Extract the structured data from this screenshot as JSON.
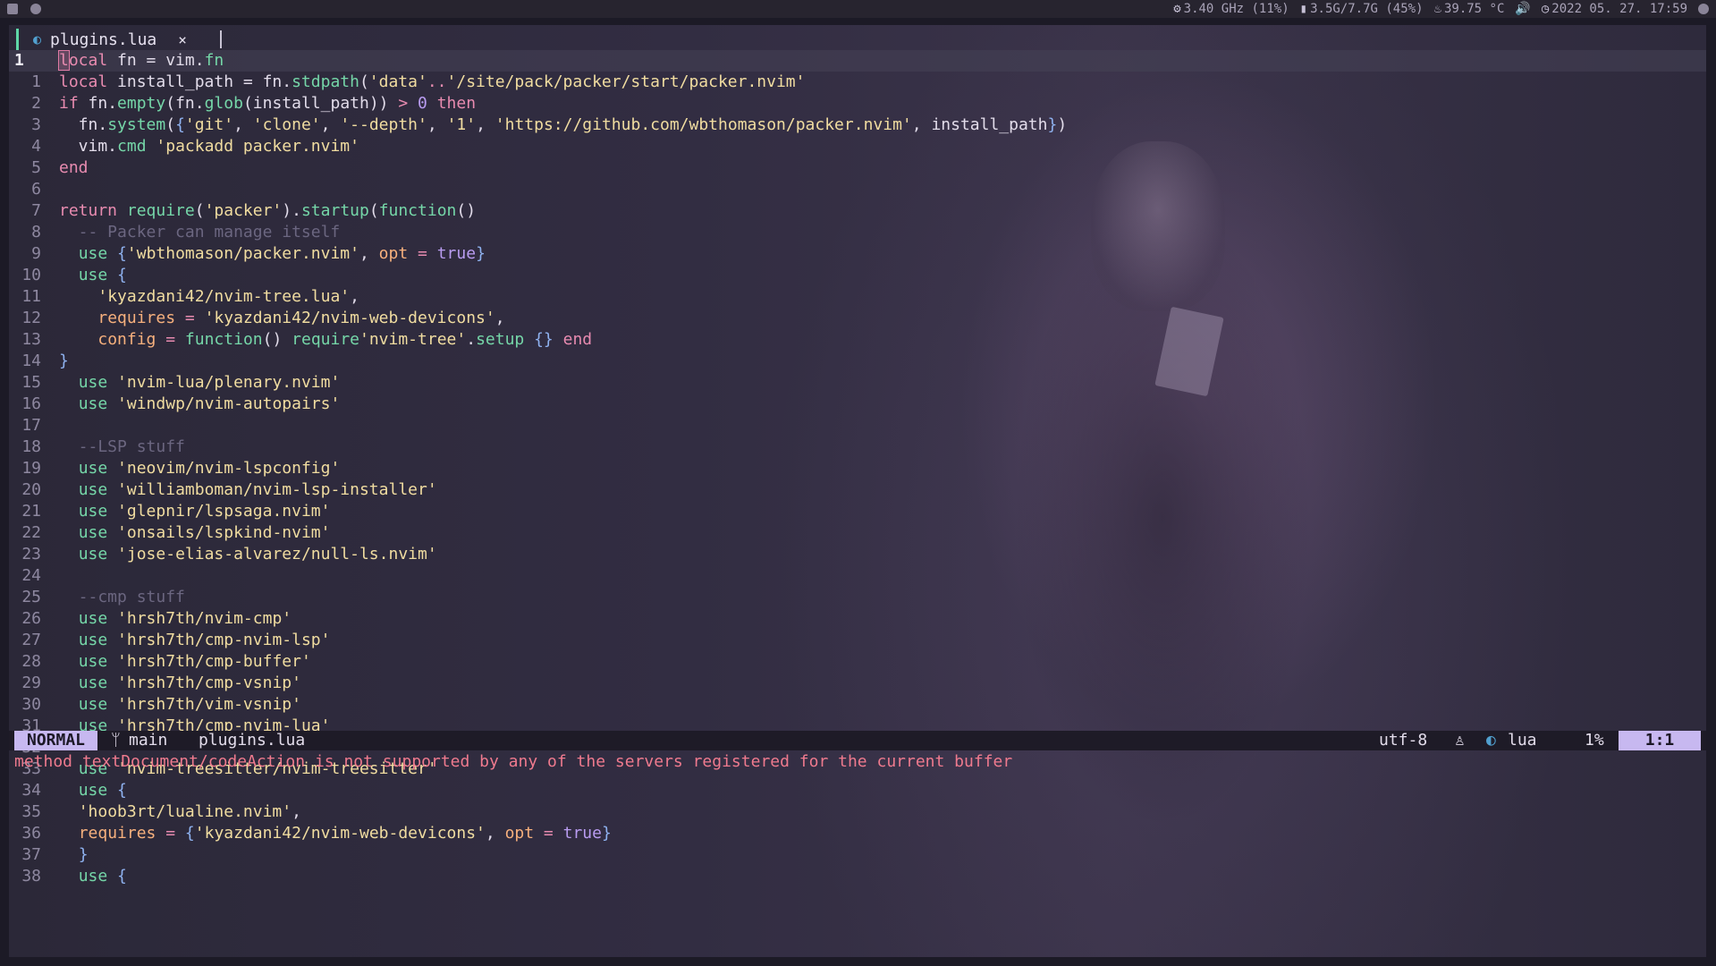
{
  "topbar": {
    "cpu": "3.40 GHz (11%)",
    "memory": "3.5G/7.7G (45%)",
    "temperature": "39.75 °C",
    "datetime": "2022 05. 27. 17:59"
  },
  "tab": {
    "filename": "plugins.lua",
    "close_glyph": "×"
  },
  "lines": [
    {
      "n": "1",
      "current": true,
      "seg": [
        [
          "cur",
          "l"
        ],
        [
          "k",
          "ocal"
        ],
        [
          "p",
          " fn = vim."
        ],
        [
          "f",
          "fn"
        ]
      ]
    },
    {
      "n": "1",
      "seg": [
        [
          "k",
          "local"
        ],
        [
          "p",
          " install_path = fn."
        ],
        [
          "f",
          "stdpath"
        ],
        [
          "p",
          "("
        ],
        [
          "s",
          "'data'"
        ],
        [
          "o",
          ".."
        ],
        [
          "s",
          "'/site/pack/packer/start/packer.nvim'"
        ]
      ]
    },
    {
      "n": "2",
      "seg": [
        [
          "k",
          "if"
        ],
        [
          "p",
          " fn."
        ],
        [
          "f",
          "empty"
        ],
        [
          "p",
          "(fn."
        ],
        [
          "f",
          "glob"
        ],
        [
          "p",
          "(install_path)) "
        ],
        [
          "o",
          ">"
        ],
        [
          "p",
          " "
        ],
        [
          "n",
          "0"
        ],
        [
          "p",
          " "
        ],
        [
          "k",
          "then"
        ]
      ]
    },
    {
      "n": "3",
      "seg": [
        [
          "p",
          "  fn."
        ],
        [
          "f",
          "system"
        ],
        [
          "p",
          "("
        ],
        [
          "b",
          "{"
        ],
        [
          "s",
          "'git'"
        ],
        [
          "p",
          ", "
        ],
        [
          "s",
          "'clone'"
        ],
        [
          "p",
          ", "
        ],
        [
          "s",
          "'--depth'"
        ],
        [
          "p",
          ", "
        ],
        [
          "s",
          "'1'"
        ],
        [
          "p",
          ", "
        ],
        [
          "s",
          "'https://github.com/wbthomason/packer.nvim'"
        ],
        [
          "p",
          ", install_path"
        ],
        [
          "b",
          "}"
        ],
        [
          "p",
          ")"
        ]
      ]
    },
    {
      "n": "4",
      "seg": [
        [
          "p",
          "  vim."
        ],
        [
          "f",
          "cmd"
        ],
        [
          "p",
          " "
        ],
        [
          "s",
          "'packadd packer.nvim'"
        ]
      ]
    },
    {
      "n": "5",
      "seg": [
        [
          "k",
          "end"
        ]
      ]
    },
    {
      "n": "6",
      "seg": []
    },
    {
      "n": "7",
      "seg": [
        [
          "k",
          "return"
        ],
        [
          "p",
          " "
        ],
        [
          "f",
          "require"
        ],
        [
          "p",
          "("
        ],
        [
          "s",
          "'packer'"
        ],
        [
          "p",
          ")."
        ],
        [
          "f",
          "startup"
        ],
        [
          "p",
          "("
        ],
        [
          "f",
          "function"
        ],
        [
          "p",
          "()"
        ]
      ]
    },
    {
      "n": "8",
      "seg": [
        [
          "c",
          "  -- Packer can manage itself"
        ]
      ]
    },
    {
      "n": "9",
      "seg": [
        [
          "p",
          "  "
        ],
        [
          "f",
          "use"
        ],
        [
          "p",
          " "
        ],
        [
          "b",
          "{"
        ],
        [
          "s",
          "'wbthomason/packer.nvim'"
        ],
        [
          "p",
          ", "
        ],
        [
          "a",
          "opt"
        ],
        [
          "p",
          " "
        ],
        [
          "o",
          "="
        ],
        [
          "p",
          " "
        ],
        [
          "n",
          "true"
        ],
        [
          "b",
          "}"
        ]
      ]
    },
    {
      "n": "10",
      "seg": [
        [
          "p",
          "  "
        ],
        [
          "f",
          "use"
        ],
        [
          "p",
          " "
        ],
        [
          "b",
          "{"
        ]
      ]
    },
    {
      "n": "11",
      "seg": [
        [
          "p",
          "    "
        ],
        [
          "s",
          "'kyazdani42/nvim-tree.lua'"
        ],
        [
          "p",
          ","
        ]
      ]
    },
    {
      "n": "12",
      "seg": [
        [
          "p",
          "    "
        ],
        [
          "a",
          "requires"
        ],
        [
          "p",
          " "
        ],
        [
          "o",
          "="
        ],
        [
          "p",
          " "
        ],
        [
          "s",
          "'kyazdani42/nvim-web-devicons'"
        ],
        [
          "p",
          ","
        ]
      ]
    },
    {
      "n": "13",
      "seg": [
        [
          "p",
          "    "
        ],
        [
          "a",
          "config"
        ],
        [
          "p",
          " "
        ],
        [
          "o",
          "="
        ],
        [
          "p",
          " "
        ],
        [
          "f",
          "function"
        ],
        [
          "p",
          "() "
        ],
        [
          "f",
          "require"
        ],
        [
          "s",
          "'nvim-tree'"
        ],
        [
          "p",
          "."
        ],
        [
          "f",
          "setup"
        ],
        [
          "p",
          " "
        ],
        [
          "b",
          "{}"
        ],
        [
          "p",
          " "
        ],
        [
          "k",
          "end"
        ]
      ]
    },
    {
      "n": "14",
      "seg": [
        [
          "b",
          "}"
        ]
      ]
    },
    {
      "n": "15",
      "seg": [
        [
          "p",
          "  "
        ],
        [
          "f",
          "use"
        ],
        [
          "p",
          " "
        ],
        [
          "s",
          "'nvim-lua/plenary.nvim'"
        ]
      ]
    },
    {
      "n": "16",
      "seg": [
        [
          "p",
          "  "
        ],
        [
          "f",
          "use"
        ],
        [
          "p",
          " "
        ],
        [
          "s",
          "'windwp/nvim-autopairs'"
        ]
      ]
    },
    {
      "n": "17",
      "seg": []
    },
    {
      "n": "18",
      "seg": [
        [
          "c",
          "  --LSP stuff"
        ]
      ]
    },
    {
      "n": "19",
      "seg": [
        [
          "p",
          "  "
        ],
        [
          "f",
          "use"
        ],
        [
          "p",
          " "
        ],
        [
          "s",
          "'neovim/nvim-lspconfig'"
        ]
      ]
    },
    {
      "n": "20",
      "seg": [
        [
          "p",
          "  "
        ],
        [
          "f",
          "use"
        ],
        [
          "p",
          " "
        ],
        [
          "s",
          "'williamboman/nvim-lsp-installer'"
        ]
      ]
    },
    {
      "n": "21",
      "seg": [
        [
          "p",
          "  "
        ],
        [
          "f",
          "use"
        ],
        [
          "p",
          " "
        ],
        [
          "s",
          "'glepnir/lspsaga.nvim'"
        ]
      ]
    },
    {
      "n": "22",
      "seg": [
        [
          "p",
          "  "
        ],
        [
          "f",
          "use"
        ],
        [
          "p",
          " "
        ],
        [
          "s",
          "'onsails/lspkind-nvim'"
        ]
      ]
    },
    {
      "n": "23",
      "seg": [
        [
          "p",
          "  "
        ],
        [
          "f",
          "use"
        ],
        [
          "p",
          " "
        ],
        [
          "s",
          "'jose-elias-alvarez/null-ls.nvim'"
        ]
      ]
    },
    {
      "n": "24",
      "seg": []
    },
    {
      "n": "25",
      "seg": [
        [
          "c",
          "  --cmp stuff"
        ]
      ]
    },
    {
      "n": "26",
      "seg": [
        [
          "p",
          "  "
        ],
        [
          "f",
          "use"
        ],
        [
          "p",
          " "
        ],
        [
          "s",
          "'hrsh7th/nvim-cmp'"
        ]
      ]
    },
    {
      "n": "27",
      "seg": [
        [
          "p",
          "  "
        ],
        [
          "f",
          "use"
        ],
        [
          "p",
          " "
        ],
        [
          "s",
          "'hrsh7th/cmp-nvim-lsp'"
        ]
      ]
    },
    {
      "n": "28",
      "seg": [
        [
          "p",
          "  "
        ],
        [
          "f",
          "use"
        ],
        [
          "p",
          " "
        ],
        [
          "s",
          "'hrsh7th/cmp-buffer'"
        ]
      ]
    },
    {
      "n": "29",
      "seg": [
        [
          "p",
          "  "
        ],
        [
          "f",
          "use"
        ],
        [
          "p",
          " "
        ],
        [
          "s",
          "'hrsh7th/cmp-vsnip'"
        ]
      ]
    },
    {
      "n": "30",
      "seg": [
        [
          "p",
          "  "
        ],
        [
          "f",
          "use"
        ],
        [
          "p",
          " "
        ],
        [
          "s",
          "'hrsh7th/vim-vsnip'"
        ]
      ]
    },
    {
      "n": "31",
      "seg": [
        [
          "p",
          "  "
        ],
        [
          "f",
          "use"
        ],
        [
          "p",
          " "
        ],
        [
          "s",
          "'hrsh7th/cmp-nvim-lua'"
        ]
      ]
    },
    {
      "n": "32",
      "seg": []
    },
    {
      "n": "33",
      "seg": [
        [
          "p",
          "  "
        ],
        [
          "f",
          "use"
        ],
        [
          "p",
          " "
        ],
        [
          "s",
          "'nvim-treesitter/nvim-treesitter'"
        ]
      ]
    },
    {
      "n": "34",
      "seg": [
        [
          "p",
          "  "
        ],
        [
          "f",
          "use"
        ],
        [
          "p",
          " "
        ],
        [
          "b",
          "{"
        ]
      ]
    },
    {
      "n": "35",
      "seg": [
        [
          "p",
          "  "
        ],
        [
          "s",
          "'hoob3rt/lualine.nvim'"
        ],
        [
          "p",
          ","
        ]
      ]
    },
    {
      "n": "36",
      "seg": [
        [
          "p",
          "  "
        ],
        [
          "a",
          "requires"
        ],
        [
          "p",
          " "
        ],
        [
          "o",
          "="
        ],
        [
          "p",
          " "
        ],
        [
          "b",
          "{"
        ],
        [
          "s",
          "'kyazdani42/nvim-web-devicons'"
        ],
        [
          "p",
          ", "
        ],
        [
          "a",
          "opt"
        ],
        [
          "p",
          " "
        ],
        [
          "o",
          "="
        ],
        [
          "p",
          " "
        ],
        [
          "n",
          "true"
        ],
        [
          "b",
          "}"
        ]
      ]
    },
    {
      "n": "37",
      "seg": [
        [
          "p",
          "  "
        ],
        [
          "b",
          "}"
        ]
      ]
    },
    {
      "n": "38",
      "seg": [
        [
          "p",
          "  "
        ],
        [
          "f",
          "use"
        ],
        [
          "p",
          " "
        ],
        [
          "b",
          "{"
        ]
      ]
    }
  ],
  "statusline": {
    "mode": "NORMAL",
    "branch": "main",
    "filename": "plugins.lua",
    "encoding": "utf-8",
    "filetype": "lua",
    "percent": "1%",
    "position": "1:1"
  },
  "message": "method textDocument/codeAction is not supported by any of the servers registered for the current buffer"
}
